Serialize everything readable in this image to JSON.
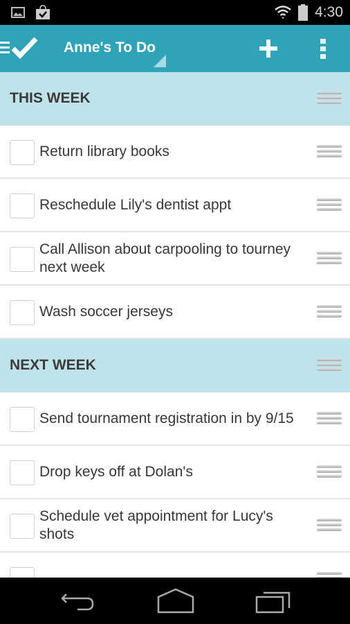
{
  "status_bar": {
    "time": "4:30",
    "left_icons": [
      "image-notification-icon",
      "shopping-bag-check-icon"
    ],
    "right_icons": [
      "wifi-icon",
      "battery-icon"
    ]
  },
  "app_bar": {
    "title": "Anne's To Do",
    "actions": [
      "add-icon",
      "overflow-menu-icon"
    ],
    "accent_color": "#2fa4b9"
  },
  "sections": [
    {
      "title": "THIS WEEK",
      "items": [
        {
          "text": "Return library books",
          "checked": false
        },
        {
          "text": "Reschedule Lily's dentist appt",
          "checked": false
        },
        {
          "text": "Call Allison about carpooling to tourney next week",
          "checked": false
        },
        {
          "text": "Wash soccer jerseys",
          "checked": false
        }
      ]
    },
    {
      "title": "NEXT WEEK",
      "items": [
        {
          "text": "Send tournament registration in by 9/15",
          "checked": false
        },
        {
          "text": "Drop keys off at Dolan's",
          "checked": false
        },
        {
          "text": "Schedule vet appointment for Lucy's shots",
          "checked": false
        },
        {
          "text": "",
          "checked": false
        }
      ]
    }
  ],
  "colors": {
    "section_header_bg": "#bee3ea",
    "app_bar_bg": "#2fa4b9"
  },
  "nav_bar": {
    "buttons": [
      "back-icon",
      "home-icon",
      "recent-apps-icon"
    ]
  }
}
